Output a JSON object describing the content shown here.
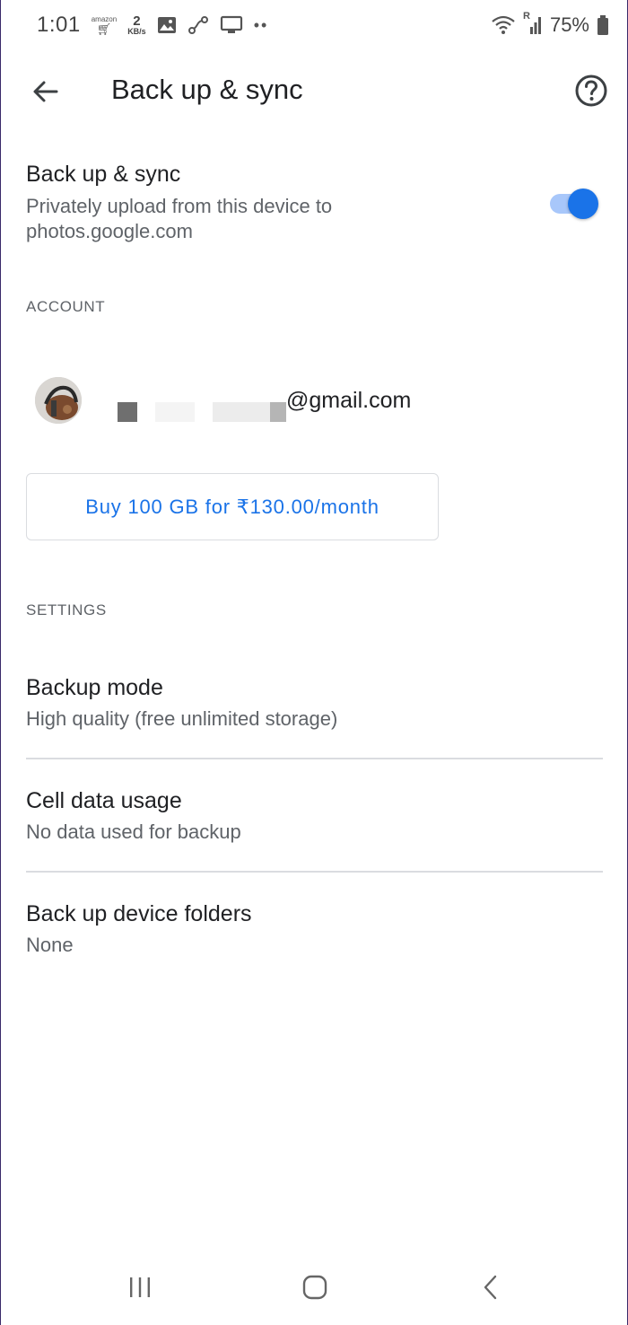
{
  "status_bar": {
    "time": "1:01",
    "amazon_label": "amazon",
    "speed_value": "2",
    "speed_unit": "KB/s",
    "roaming_label": "R",
    "battery": "75%",
    "icons": [
      "amazon-cart-icon",
      "image-icon",
      "share-icon",
      "tv-icon",
      "more-dots-icon",
      "wifi-icon",
      "signal-icon",
      "battery-icon"
    ]
  },
  "app_bar": {
    "title": "Back up & sync",
    "back_icon": "back-arrow-icon",
    "help_icon": "help-icon"
  },
  "sync": {
    "title": "Back up & sync",
    "description": "Privately upload from this device to photos.google.com",
    "enabled": true,
    "toggle_color": "#1a73e8"
  },
  "account_section": {
    "header": "ACCOUNT",
    "email_suffix": "gmail.com",
    "email_visible": "@gmail.com"
  },
  "buy_button": {
    "label": "Buy 100 GB for ₹130.00/month",
    "color": "#1a73e8"
  },
  "settings_section": {
    "header": "SETTINGS",
    "items": [
      {
        "title": "Backup mode",
        "subtitle": "High quality (free unlimited storage)"
      },
      {
        "title": "Cell data usage",
        "subtitle": "No data used for backup"
      },
      {
        "title": "Back up device folders",
        "subtitle": "None"
      }
    ]
  },
  "nav_bar": {
    "icons": [
      "recent-apps-icon",
      "home-icon",
      "back-icon"
    ]
  }
}
